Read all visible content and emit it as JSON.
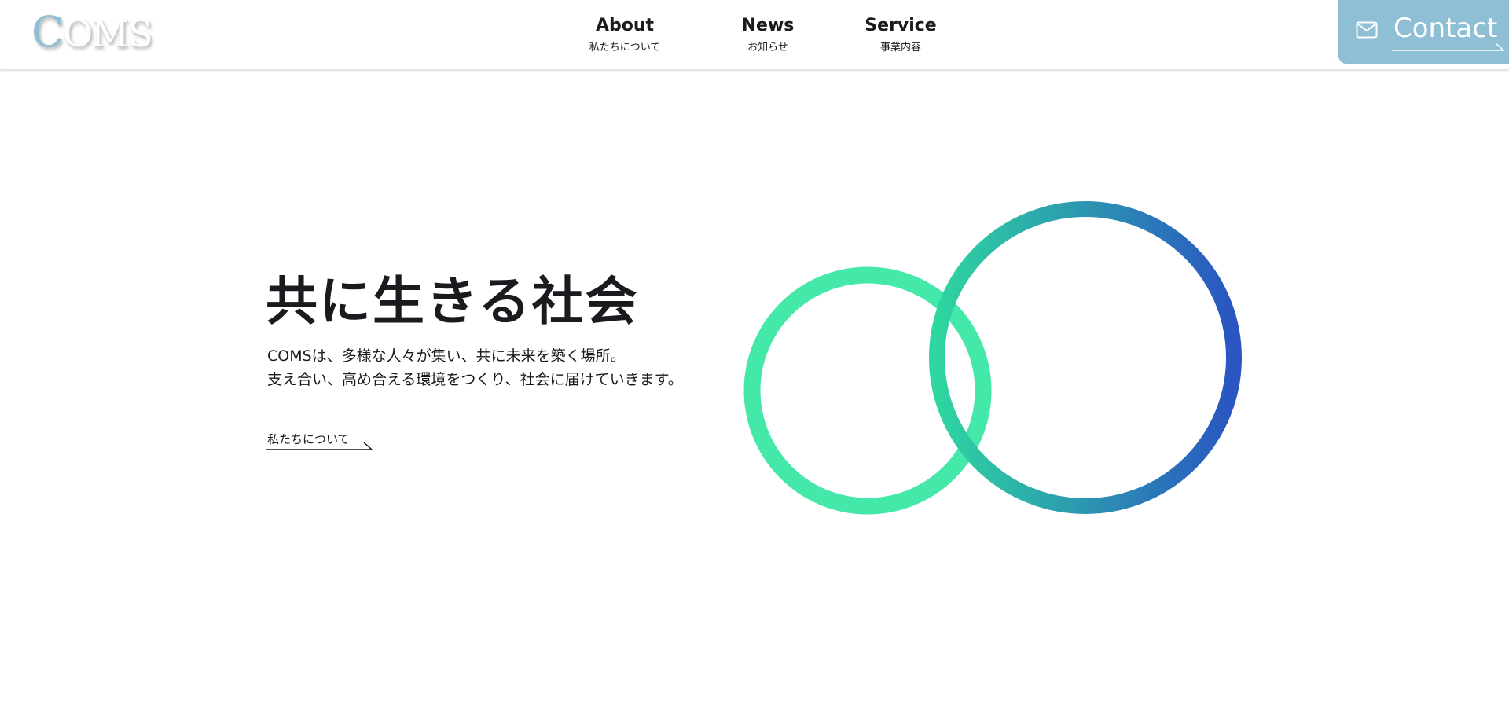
{
  "header": {
    "logo_first": "C",
    "logo_rest": "OMS",
    "nav": [
      {
        "en": "About",
        "ja": "私たちについて"
      },
      {
        "en": "News",
        "ja": "お知らせ"
      },
      {
        "en": "Service",
        "ja": "事業内容"
      }
    ],
    "contact_label": "Contact",
    "contact_icon": "mail-icon"
  },
  "hero": {
    "title": "共に生きる社会",
    "lines": [
      "COMSは、多様な人々が集い、共に未来を築く場所。",
      "支え合い、高め合える環境をつくり、社会に届けていきます。"
    ],
    "link_label": "私たちについて",
    "link_icon": "arrow-right-icon"
  },
  "colors": {
    "accent": "#8fbfd4",
    "circle_left": "#44e8a8",
    "circle_right_start": "#2ed6a0",
    "circle_right_end": "#2a55c2",
    "text": "#1d1a1f"
  }
}
